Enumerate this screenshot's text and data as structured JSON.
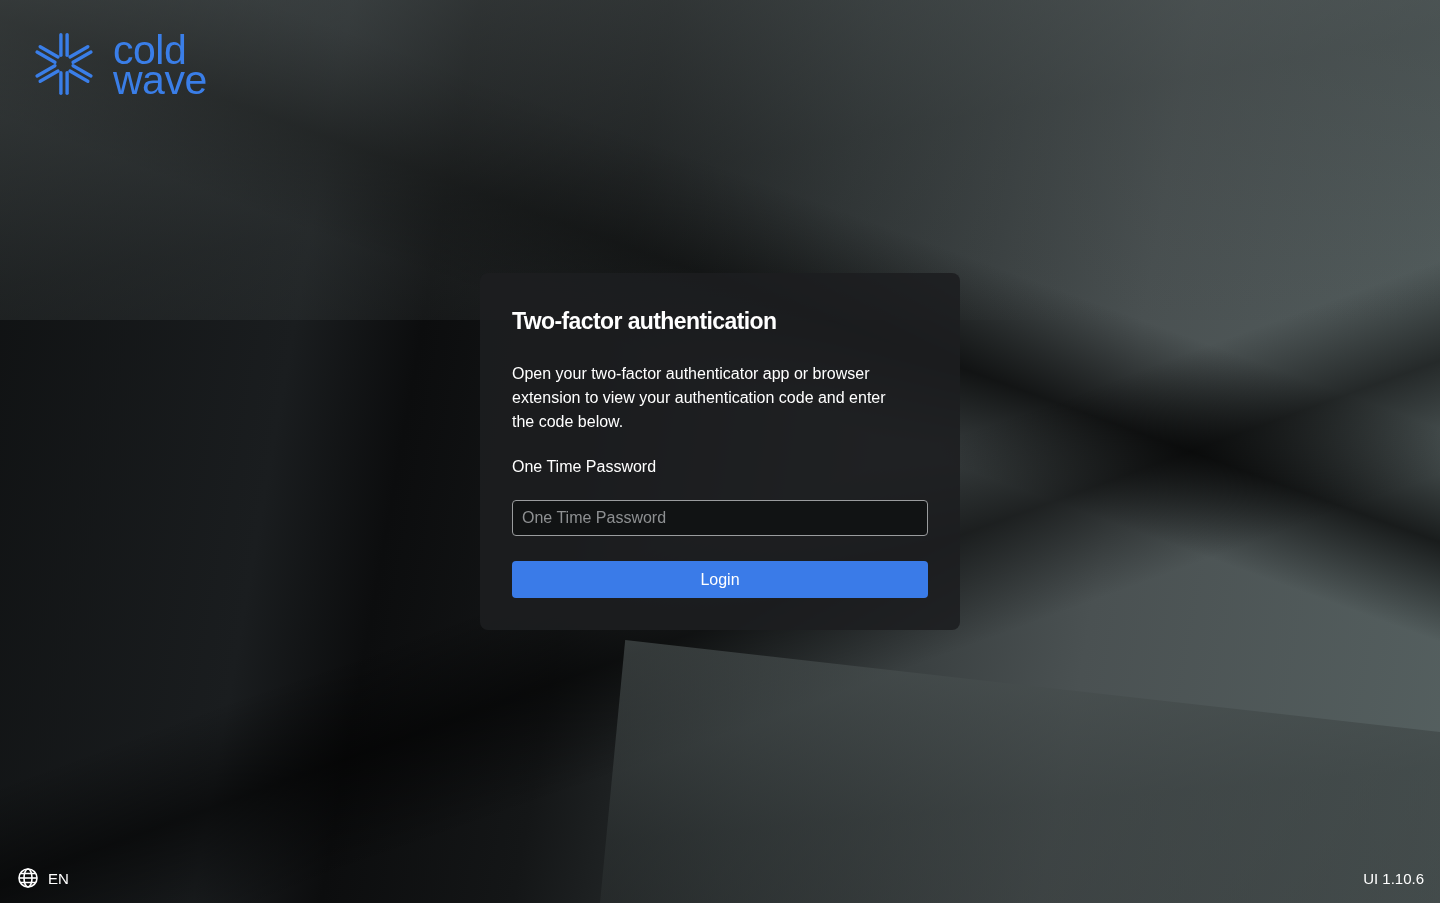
{
  "logo": {
    "wordmark": "cold wave"
  },
  "card": {
    "title": "Two-factor authentication",
    "description": "Open your two-factor authenticator app or browser extension to view your authentication code and enter the code below.",
    "field": {
      "label": "One Time Password",
      "placeholder": "One Time Password"
    },
    "submit": {
      "label": "Login"
    }
  },
  "footer": {
    "language": {
      "label": "EN"
    },
    "version": "UI 1.10.6"
  }
}
